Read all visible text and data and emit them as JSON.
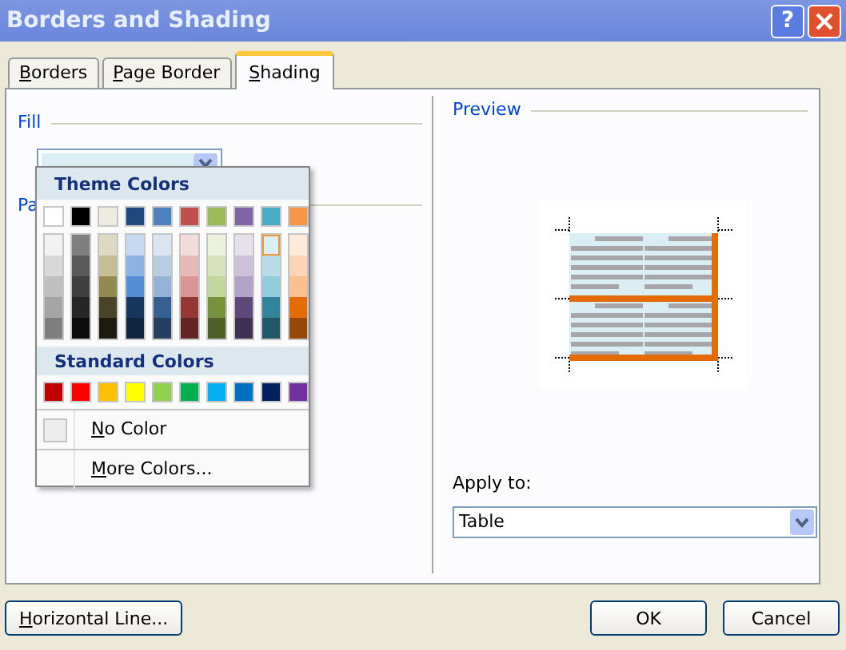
{
  "window": {
    "title": "Borders and Shading",
    "help": "?"
  },
  "tabs": [
    {
      "label": "Borders",
      "selected": false
    },
    {
      "label": "Page Border",
      "selected": false
    },
    {
      "label": "Shading",
      "selected": true
    }
  ],
  "fill": {
    "heading": "Fill"
  },
  "patterns": {
    "heading": "Pa"
  },
  "color_menu": {
    "theme_heading": "Theme Colors",
    "theme_columns": [
      {
        "color": "#ffffff",
        "shades": [
          {
            "color": "#f2f2f2",
            "selected": false
          },
          {
            "color": "#d8d8d8",
            "selected": false
          },
          {
            "color": "#bfbfbf",
            "selected": false
          },
          {
            "color": "#a5a5a5",
            "selected": false
          },
          {
            "color": "#7f7f7f",
            "selected": false
          }
        ]
      },
      {
        "color": "#000000",
        "shades": [
          {
            "color": "#7f7f7f",
            "selected": false
          },
          {
            "color": "#595959",
            "selected": false
          },
          {
            "color": "#3f3f3f",
            "selected": false
          },
          {
            "color": "#262626",
            "selected": false
          },
          {
            "color": "#0c0c0c",
            "selected": false
          }
        ]
      },
      {
        "color": "#eeece1",
        "shades": [
          {
            "color": "#ddd9c3",
            "selected": false
          },
          {
            "color": "#c4bd97",
            "selected": false
          },
          {
            "color": "#938953",
            "selected": false
          },
          {
            "color": "#494429",
            "selected": false
          },
          {
            "color": "#1d1b10",
            "selected": false
          }
        ]
      },
      {
        "color": "#1f497d",
        "shades": [
          {
            "color": "#c6d9f0",
            "selected": false
          },
          {
            "color": "#8db3e2",
            "selected": false
          },
          {
            "color": "#548dd4",
            "selected": false
          },
          {
            "color": "#17365d",
            "selected": false
          },
          {
            "color": "#0f243e",
            "selected": false
          }
        ]
      },
      {
        "color": "#4f81bd",
        "shades": [
          {
            "color": "#dbe5f1",
            "selected": false
          },
          {
            "color": "#b8cce4",
            "selected": false
          },
          {
            "color": "#95b3d7",
            "selected": false
          },
          {
            "color": "#366092",
            "selected": false
          },
          {
            "color": "#244061",
            "selected": false
          }
        ]
      },
      {
        "color": "#c0504d",
        "shades": [
          {
            "color": "#f2dcdb",
            "selected": false
          },
          {
            "color": "#e5b9b7",
            "selected": false
          },
          {
            "color": "#d99694",
            "selected": false
          },
          {
            "color": "#953734",
            "selected": false
          },
          {
            "color": "#632423",
            "selected": false
          }
        ]
      },
      {
        "color": "#9bbb59",
        "shades": [
          {
            "color": "#ebf1dd",
            "selected": false
          },
          {
            "color": "#d7e3bc",
            "selected": false
          },
          {
            "color": "#c3d69b",
            "selected": false
          },
          {
            "color": "#76923c",
            "selected": false
          },
          {
            "color": "#4f6128",
            "selected": false
          }
        ]
      },
      {
        "color": "#8064a2",
        "shades": [
          {
            "color": "#e5e0ec",
            "selected": false
          },
          {
            "color": "#ccc1d9",
            "selected": false
          },
          {
            "color": "#b2a2c7",
            "selected": false
          },
          {
            "color": "#5f497a",
            "selected": false
          },
          {
            "color": "#3f3151",
            "selected": false
          }
        ]
      },
      {
        "color": "#4bacc6",
        "shades": [
          {
            "color": "#dbeef3",
            "selected": true
          },
          {
            "color": "#b7dde8",
            "selected": false
          },
          {
            "color": "#92cddc",
            "selected": false
          },
          {
            "color": "#31859b",
            "selected": false
          },
          {
            "color": "#205867",
            "selected": false
          }
        ]
      },
      {
        "color": "#f79646",
        "shades": [
          {
            "color": "#fdeada",
            "selected": false
          },
          {
            "color": "#fbd5b5",
            "selected": false
          },
          {
            "color": "#fac08f",
            "selected": false
          },
          {
            "color": "#e36c09",
            "selected": false
          },
          {
            "color": "#974806",
            "selected": false
          }
        ]
      }
    ],
    "standard_heading": "Standard Colors",
    "standard_colors": [
      {
        "color": "#c00000"
      },
      {
        "color": "#ff0000"
      },
      {
        "color": "#ffc000"
      },
      {
        "color": "#ffff00"
      },
      {
        "color": "#92d050"
      },
      {
        "color": "#00b050"
      },
      {
        "color": "#00b0f0"
      },
      {
        "color": "#0070c0"
      },
      {
        "color": "#002060"
      },
      {
        "color": "#7030a0"
      }
    ],
    "items": [
      {
        "kind": "swatch",
        "label": "No Color"
      },
      {
        "kind": "plain",
        "label": "More Colors..."
      }
    ]
  },
  "preview": {
    "heading": "Preview"
  },
  "apply_to": {
    "label": "Apply to:",
    "value": "Table"
  },
  "buttons": [
    {
      "label": "Horizontal Line...",
      "mnemonic": true
    },
    {
      "label": "OK",
      "mnemonic": false
    },
    {
      "label": "Cancel",
      "mnemonic": false
    }
  ]
}
